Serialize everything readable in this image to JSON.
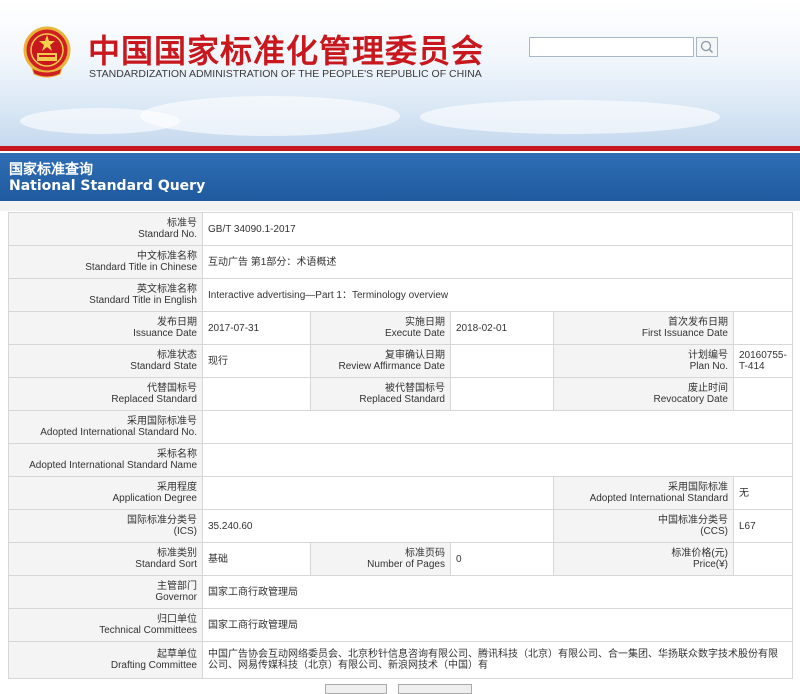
{
  "header": {
    "title_cn": "中国国家标准化管理委员会",
    "title_en": "STANDARDIZATION ADMINISTRATION OF THE PEOPLE'S REPUBLIC OF CHINA",
    "search_value": "",
    "colors": {
      "brand_red": "#c8181e",
      "bar_blue": "#2866ad"
    }
  },
  "section": {
    "title_cn": "国家标准查询",
    "title_en": "National Standard Query"
  },
  "fields": {
    "standard_no": {
      "zh": "标准号",
      "en": "Standard No.",
      "value": "GB/T 34090.1-2017"
    },
    "title_cn": {
      "zh": "中文标准名称",
      "en": "Standard Title in Chinese",
      "value": "互动广告 第1部分：术语概述"
    },
    "title_en": {
      "zh": "英文标准名称",
      "en": "Standard Title in English",
      "value": "Interactive advertising—Part 1：Terminology overview"
    },
    "issuance_date": {
      "zh": "发布日期",
      "en": "Issuance Date",
      "value": "2017-07-31"
    },
    "execute_date": {
      "zh": "实施日期",
      "en": "Execute Date",
      "value": "2018-02-01"
    },
    "first_issuance": {
      "zh": "首次发布日期",
      "en": "First Issuance Date",
      "value": ""
    },
    "standard_state": {
      "zh": "标准状态",
      "en": "Standard State",
      "value": "现行"
    },
    "review_date": {
      "zh": "复审确认日期",
      "en": "Review Affirmance Date",
      "value": ""
    },
    "plan_no": {
      "zh": "计划编号",
      "en": "Plan No.",
      "value": "20160755-T-414"
    },
    "replaced_standard": {
      "zh": "代替国标号",
      "en": "Replaced Standard",
      "value": ""
    },
    "replaced_by": {
      "zh": "被代替国标号",
      "en": "Replaced Standard",
      "value": ""
    },
    "revocatory_date": {
      "zh": "废止时间",
      "en": "Revocatory Date",
      "value": ""
    },
    "adopted_intl_no": {
      "zh": "采用国际标准号",
      "en": "Adopted International Standard No.",
      "value": ""
    },
    "adopted_intl_name": {
      "zh": "采标名称",
      "en": "Adopted International Standard Name",
      "value": ""
    },
    "application_degree": {
      "zh": "采用程度",
      "en": "Application Degree",
      "value": ""
    },
    "adopted_intl": {
      "zh": "采用国际标准",
      "en": "Adopted International Standard",
      "value": "无"
    },
    "ics": {
      "zh": "国际标准分类号",
      "en": "(ICS)",
      "value": "35.240.60"
    },
    "ccs": {
      "zh": "中国标准分类号",
      "en": "(CCS)",
      "value": "L67"
    },
    "standard_sort": {
      "zh": "标准类别",
      "en": "Standard Sort",
      "value": "基础"
    },
    "pages": {
      "zh": "标准页码",
      "en": "Number of Pages",
      "value": "0"
    },
    "price": {
      "zh": "标准价格(元)",
      "en": "Price(¥)",
      "value": ""
    },
    "governor": {
      "zh": "主管部门",
      "en": "Governor",
      "value": "国家工商行政管理局"
    },
    "technical_committees": {
      "zh": "归口单位",
      "en": "Technical Committees",
      "value": "国家工商行政管理局"
    },
    "drafting_committee": {
      "zh": "起草单位",
      "en": "Drafting Committee",
      "value": "中国广告协会互动网络委员会、北京秒针信息咨询有限公司、腾讯科技（北京）有限公司、合一集团、华扬联众数字技术股份有限公司、网易传媒科技（北京）有限公司、新浪网技术（中国）有"
    }
  }
}
